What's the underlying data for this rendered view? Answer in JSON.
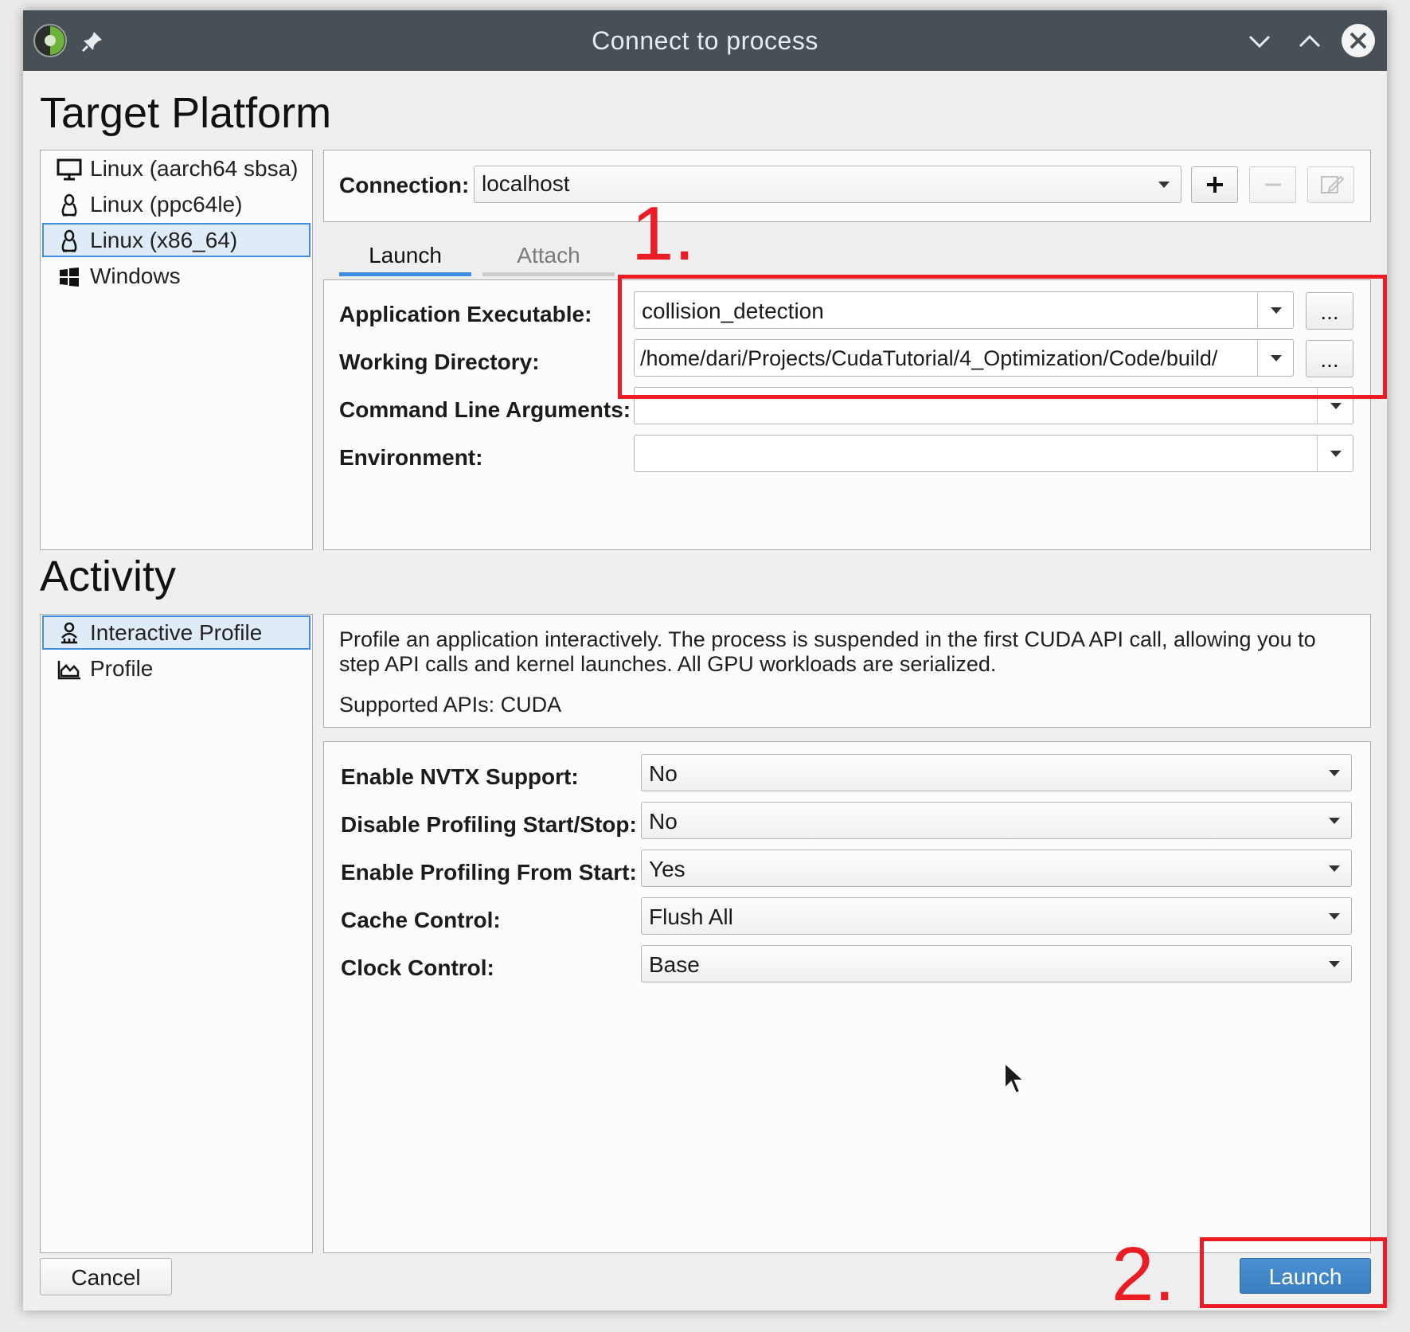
{
  "window": {
    "title": "Connect to process",
    "title_buttons": [
      "minimize",
      "maximize",
      "close"
    ]
  },
  "target_platform": {
    "heading": "Target Platform",
    "platforms": [
      {
        "label": "Linux (aarch64 sbsa)",
        "icon": "monitor-icon",
        "selected": false
      },
      {
        "label": "Linux (ppc64le)",
        "icon": "linux-penguin-icon",
        "selected": false
      },
      {
        "label": "Linux (x86_64)",
        "icon": "linux-penguin-icon",
        "selected": true
      },
      {
        "label": "Windows",
        "icon": "windows-logo-icon",
        "selected": false
      }
    ],
    "connection_label": "Connection:",
    "connection_value": "localhost",
    "tabs": [
      {
        "label": "Launch",
        "active": true
      },
      {
        "label": "Attach",
        "active": false
      }
    ],
    "fields": {
      "app_exe_label": "Application Executable:",
      "app_exe_value": "collision_detection",
      "workdir_label": "Working Directory:",
      "workdir_value": "/home/dari/Projects/CudaTutorial/4_Optimization/Code/build/",
      "cmdargs_label": "Command Line Arguments:",
      "cmdargs_value": "",
      "env_label": "Environment:",
      "env_value": "",
      "browse_label": "..."
    }
  },
  "activity": {
    "heading": "Activity",
    "items": [
      {
        "label": "Interactive Profile",
        "icon": "interactive-profile-icon",
        "selected": true
      },
      {
        "label": "Profile",
        "icon": "profile-chart-icon",
        "selected": false
      }
    ],
    "description": "Profile an application interactively. The process is suspended in the first CUDA API call, allowing you to step API calls and kernel launches. All GPU workloads are serialized.",
    "supported_apis": "Supported APIs: CUDA",
    "options": [
      {
        "label": "Enable NVTX Support:",
        "value": "No"
      },
      {
        "label": "Disable Profiling Start/Stop:",
        "value": "No"
      },
      {
        "label": "Enable Profiling From Start:",
        "value": "Yes"
      },
      {
        "label": "Cache Control:",
        "value": "Flush All"
      },
      {
        "label": "Clock Control:",
        "value": "Base"
      }
    ]
  },
  "buttons": {
    "cancel": "Cancel",
    "launch": "Launch"
  },
  "annotations": {
    "step1": "1.",
    "step2": "2.",
    "color": "#ec1c24"
  },
  "colors": {
    "titlebar": "#475057",
    "selection_border": "#3d8ee0",
    "selection_fill": "#dfebf6",
    "launch_button": "#3a7fc0"
  }
}
